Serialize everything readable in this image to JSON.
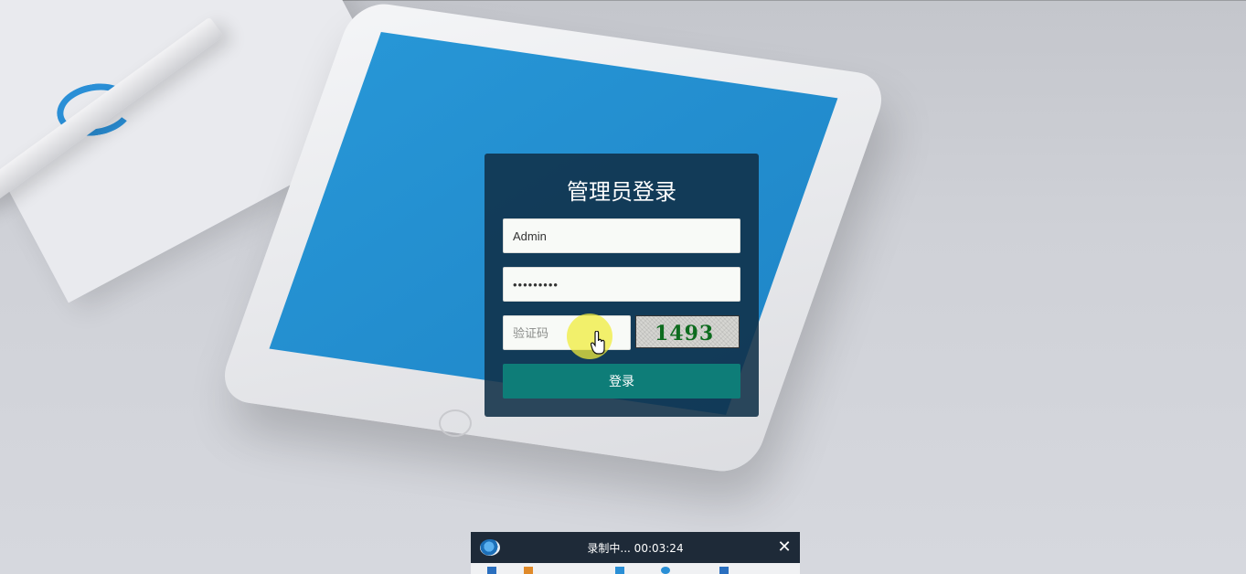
{
  "login": {
    "title": "管理员登录",
    "username_value": "Admin",
    "password_value": "•••••••••",
    "captcha_placeholder": "验证码",
    "captcha_code": "1493",
    "submit_label": "登录"
  },
  "recorder": {
    "status": "录制中... 00:03:24",
    "close_glyph": "✕"
  },
  "colors": {
    "panel_bg": "#103048",
    "button_bg": "#0e7d78",
    "captcha_text": "#0d6b1e",
    "tablet_screen": "#2796d6"
  },
  "icons": [
    "camera-icon",
    "close-icon",
    "hand-cursor-icon"
  ]
}
